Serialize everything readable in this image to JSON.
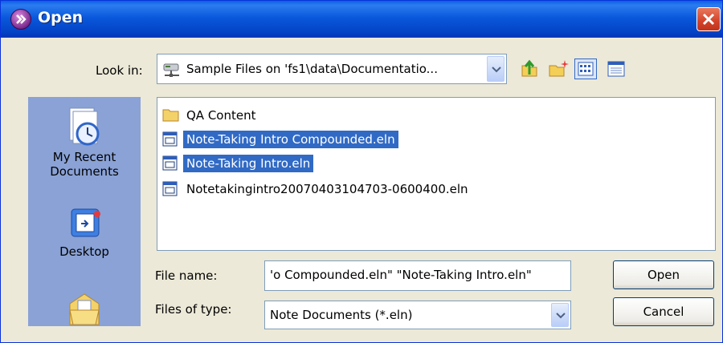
{
  "window": {
    "title": "Open",
    "app_icon": "open-dialog-icon",
    "close_icon": "close-icon"
  },
  "look_in": {
    "label": "Look in:",
    "value": "Sample Files on 'fs1\\data\\Documentatio...",
    "icon": "network-drive-icon"
  },
  "toolbar": {
    "buttons": [
      "up-folder-icon",
      "new-folder-icon",
      "view-menu-icon",
      "details-view-icon"
    ]
  },
  "places": [
    {
      "label": "My Recent Documents",
      "icon": "recent-documents-icon"
    },
    {
      "label": "Desktop",
      "icon": "desktop-icon"
    },
    {
      "label": "",
      "icon": "my-documents-icon"
    }
  ],
  "files": [
    {
      "name": "QA Content",
      "type": "folder",
      "selected": false
    },
    {
      "name": "Note-Taking Intro Compounded.eln",
      "type": "eln",
      "selected": true
    },
    {
      "name": "Note-Taking Intro.eln",
      "type": "eln",
      "selected": true
    },
    {
      "name": "Notetakingintro20070403104703-0600400.eln",
      "type": "eln",
      "selected": false
    }
  ],
  "file_name": {
    "label": "File name:",
    "value": "'o Compounded.eln\" \"Note-Taking Intro.eln\""
  },
  "file_type": {
    "label": "Files of type:",
    "value": "Note Documents (*.eln)"
  },
  "buttons": {
    "open": "Open",
    "cancel": "Cancel"
  },
  "colors": {
    "titlebar": "#0A58DC",
    "selection": "#316AC5",
    "places_bar": "#8AA2D6",
    "dialog_bg": "#ECE9D8"
  }
}
